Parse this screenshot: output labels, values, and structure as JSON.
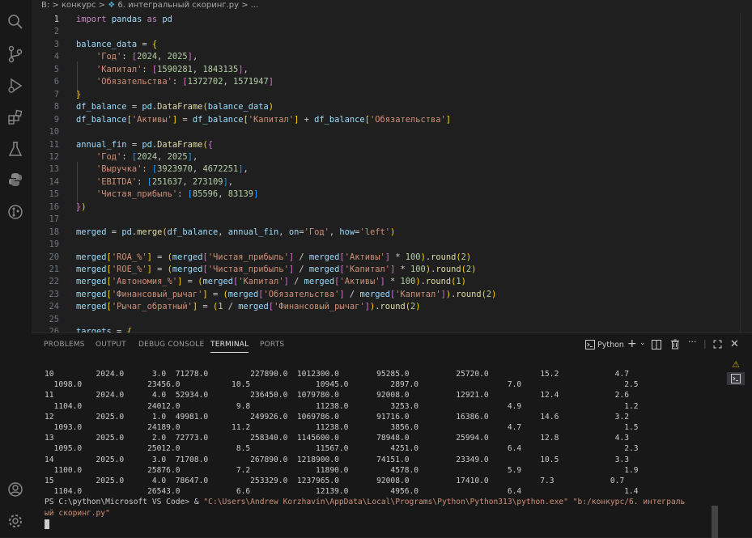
{
  "breadcrumb": {
    "folder": "B: > конкурс",
    "sep": ">",
    "file": "6. интегральный скоринг.py",
    "tail": "> ..."
  },
  "activity_bar": [
    "explorer-search-icon",
    "source-control-icon",
    "run-debug-icon",
    "extensions-icon",
    "testing-icon",
    "python-icon",
    "git-history-icon",
    "account-icon",
    "settings-gear-icon"
  ],
  "editor": {
    "lines": [
      {
        "n": "1",
        "html": "<span class='kwc'>import</span> <span class='var'>pandas</span> <span class='kwc'>as</span> <span class='var'>pd</span>"
      },
      {
        "n": "2",
        "html": ""
      },
      {
        "n": "3",
        "html": "<span class='var'>balance_data</span> = <span class='br'>{</span>"
      },
      {
        "n": "4",
        "html": "    <span class='str'>'Год'</span>: <span class='br2'>[</span><span class='num'>2024</span>, <span class='num'>2025</span><span class='br2'>]</span>,"
      },
      {
        "n": "5",
        "html": "    <span class='str'>'Капитал'</span>: <span class='br2'>[</span><span class='num'>1590281</span>, <span class='num'>1843135</span><span class='br2'>]</span>,"
      },
      {
        "n": "6",
        "html": "    <span class='str'>'Обязательства'</span>: <span class='br2'>[</span><span class='num'>1372702</span>, <span class='num'>1571947</span><span class='br2'>]</span>"
      },
      {
        "n": "7",
        "html": "<span class='br'>}</span>"
      },
      {
        "n": "8",
        "html": "<span class='var'>df_balance</span> = <span class='var'>pd</span>.<span class='fn'>DataFrame</span><span class='br'>(</span><span class='var'>balance_data</span><span class='br'>)</span>"
      },
      {
        "n": "9",
        "html": "<span class='var'>df_balance</span><span class='br'>[</span><span class='str'>'Активы'</span><span class='br'>]</span> = <span class='var'>df_balance</span><span class='br'>[</span><span class='str'>'Капитал'</span><span class='br'>]</span> + <span class='var'>df_balance</span><span class='br'>[</span><span class='str'>'Обязательства'</span><span class='br'>]</span>"
      },
      {
        "n": "10",
        "html": ""
      },
      {
        "n": "11",
        "html": "<span class='var'>annual_fin</span> = <span class='var'>pd</span>.<span class='fn'>DataFrame</span><span class='br'>(</span><span class='br2'>{</span>"
      },
      {
        "n": "12",
        "html": "    <span class='str'>'Год'</span>: <span class='br3'>[</span><span class='num'>2024</span>, <span class='num'>2025</span><span class='br3'>]</span>,"
      },
      {
        "n": "13",
        "html": "    <span class='str'>'Выручка'</span>: <span class='br3'>[</span><span class='num'>3923970</span>, <span class='num'>4672251</span><span class='br3'>]</span>,"
      },
      {
        "n": "14",
        "html": "    <span class='str'>'EBITDA'</span>: <span class='br3'>[</span><span class='num'>251637</span>, <span class='num'>273109</span><span class='br3'>]</span>,"
      },
      {
        "n": "15",
        "html": "    <span class='str'>'Чистая_прибыль'</span>: <span class='br3'>[</span><span class='num'>85596</span>, <span class='num'>83139</span><span class='br3'>]</span>"
      },
      {
        "n": "16",
        "html": "<span class='br2'>}</span><span class='br'>)</span>"
      },
      {
        "n": "17",
        "html": ""
      },
      {
        "n": "18",
        "html": "<span class='var'>merged</span> = <span class='var'>pd</span>.<span class='fn'>merge</span><span class='br'>(</span><span class='var'>df_balance</span>, <span class='var'>annual_fin</span>, <span class='var'>on</span>=<span class='str'>'Год'</span>, <span class='var'>how</span>=<span class='str'>'left'</span><span class='br'>)</span>"
      },
      {
        "n": "19",
        "html": ""
      },
      {
        "n": "20",
        "html": "<span class='var'>merged</span><span class='br'>[</span><span class='str'>'ROA_%'</span><span class='br'>]</span> = <span class='br'>(</span><span class='var'>merged</span><span class='br2'>[</span><span class='str'>'Чистая_прибыль'</span><span class='br2'>]</span> / <span class='var'>merged</span><span class='br2'>[</span><span class='str'>'Активы'</span><span class='br2'>]</span> * <span class='num'>100</span><span class='br'>)</span>.<span class='fn'>round</span><span class='br'>(</span><span class='num'>2</span><span class='br'>)</span>"
      },
      {
        "n": "21",
        "html": "<span class='var'>merged</span><span class='br'>[</span><span class='str'>'ROE_%'</span><span class='br'>]</span> = <span class='br'>(</span><span class='var'>merged</span><span class='br2'>[</span><span class='str'>'Чистая_прибыль'</span><span class='br2'>]</span> / <span class='var'>merged</span><span class='br2'>[</span><span class='str'>'Капитал'</span><span class='br2'>]</span> * <span class='num'>100</span><span class='br'>)</span>.<span class='fn'>round</span><span class='br'>(</span><span class='num'>2</span><span class='br'>)</span>"
      },
      {
        "n": "22",
        "html": "<span class='var'>merged</span><span class='br'>[</span><span class='str'>'Автономия_%'</span><span class='br'>]</span> = <span class='br'>(</span><span class='var'>merged</span><span class='br2'>[</span><span class='str'>'Капитал'</span><span class='br2'>]</span> / <span class='var'>merged</span><span class='br2'>[</span><span class='str'>'Активы'</span><span class='br2'>]</span> * <span class='num'>100</span><span class='br'>)</span>.<span class='fn'>round</span><span class='br'>(</span><span class='num'>1</span><span class='br'>)</span>"
      },
      {
        "n": "23",
        "html": "<span class='var'>merged</span><span class='br'>[</span><span class='str'>'Финансовый_рычаг'</span><span class='br'>]</span> = <span class='br'>(</span><span class='var'>merged</span><span class='br2'>[</span><span class='str'>'Обязательства'</span><span class='br2'>]</span> / <span class='var'>merged</span><span class='br2'>[</span><span class='str'>'Капитал'</span><span class='br2'>]</span><span class='br'>)</span>.<span class='fn'>round</span><span class='br'>(</span><span class='num'>2</span><span class='br'>)</span>"
      },
      {
        "n": "24",
        "html": "<span class='var'>merged</span><span class='br'>[</span><span class='str'>'Рычаг_обратный'</span><span class='br'>]</span> = <span class='br'>(</span><span class='num'>1</span> / <span class='var'>merged</span><span class='br2'>[</span><span class='str'>'Финансовый_рычаг'</span><span class='br2'>]</span><span class='br'>)</span>.<span class='fn'>round</span><span class='br'>(</span><span class='num'>2</span><span class='br'>)</span>"
      },
      {
        "n": "25",
        "html": ""
      },
      {
        "n": "26",
        "html": "<span class='var'>targets</span> = <span class='br'>{</span>"
      }
    ]
  },
  "panel": {
    "tabs": [
      "PROBLEMS",
      "OUTPUT",
      "DEBUG CONSOLE",
      "TERMINAL",
      "PORTS"
    ],
    "active_tab": "TERMINAL",
    "terminal_name": "Python",
    "terminal_lines": [
      "10         2024.0      3.0  71278.0         227890.0  1012300.0        95285.0          25720.0           15.2            4.7",
      "  1098.0              23456.0           10.5              10945.0         2897.0                   7.0                      2.5",
      "11         2024.0      4.0  52934.0         236450.0  1079780.0        92008.0          12921.0           12.4            2.6",
      "  1104.0              24012.0            9.8              11238.0         3253.0                   4.9                      1.2",
      "12         2025.0      1.0  49981.0         249926.0  1069786.0        91716.0          16386.0           14.6            3.2",
      "  1093.0              24189.0           11.2              11238.0         3856.0                   4.7                      1.5",
      "13         2025.0      2.0  72773.0         258340.0  1145600.0        78948.0          25994.0           12.8            4.3",
      "  1095.0              25012.0            8.5              11567.0         4251.0                   6.4                      2.3",
      "14         2025.0      3.0  71708.0         267890.0  1218900.0        74151.0          23349.0           10.5            3.3",
      "  1100.0              25876.0            7.2              11890.0         4578.0                   5.9                      1.9",
      "15         2025.0      4.0  78647.0         253329.0  1237965.0        92008.0          17410.0           7.3            0.7",
      "  1104.0              26543.0            6.6              12139.0         4956.0                   6.4                      1.4"
    ],
    "prompt": "PS C:\\python\\Microsoft VS Code> & ",
    "cmd1": "\"C:\\Users\\Andrew Korzhavin\\AppData\\Local\\Programs\\Python\\Python313\\python.exe\" \"b:/конкурс/6. интеграль",
    "cmd2": "ый скоринг.py\""
  }
}
